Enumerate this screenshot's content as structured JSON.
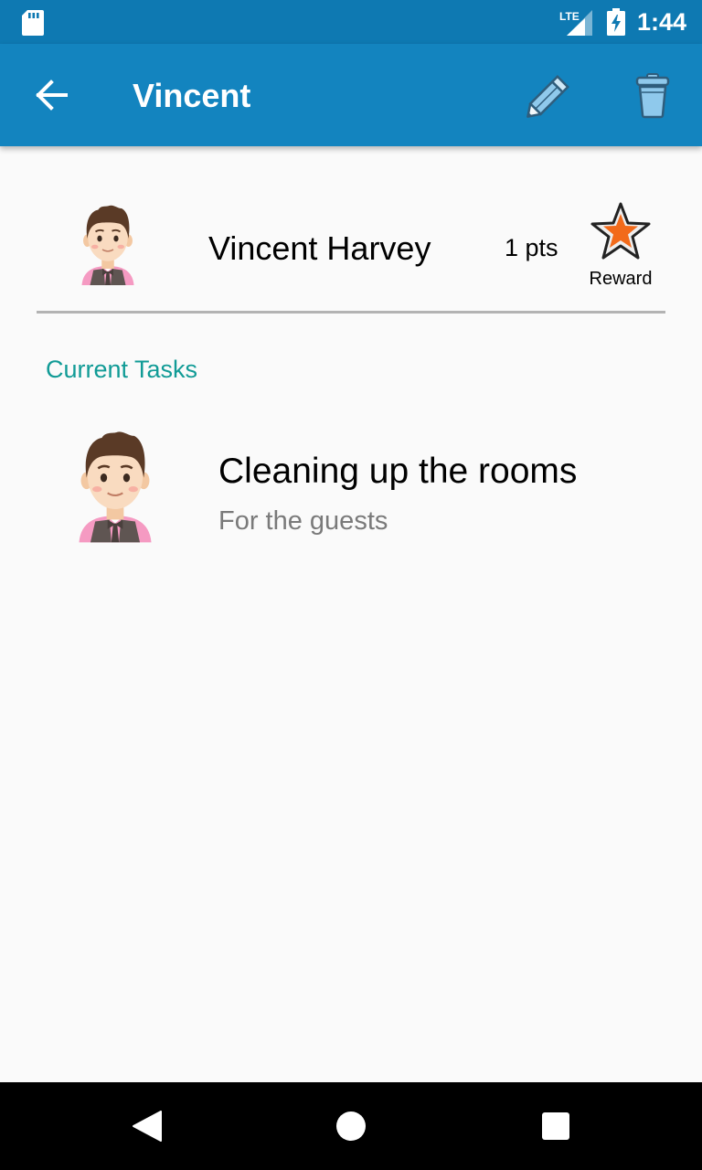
{
  "status_bar": {
    "time": "1:44",
    "network_label": "LTE",
    "icons": [
      "sd-card-icon",
      "lte-signal-icon",
      "battery-charging-icon"
    ]
  },
  "app_bar": {
    "title": "Vincent",
    "icons": [
      "back-arrow-icon",
      "pencil-icon",
      "trash-icon"
    ],
    "color": "#1384bf"
  },
  "profile": {
    "name": "Vincent Harvey",
    "points": "1 pts",
    "reward_label": "Reward",
    "avatar_icon": "waiter-avatar-icon",
    "reward_icon": "star-icon"
  },
  "tasks_section": {
    "heading": "Current Tasks",
    "heading_color": "#119b96",
    "tasks": [
      {
        "title": "Cleaning up the rooms",
        "subtitle": "For the guests",
        "icon": "waiter-avatar-icon"
      }
    ]
  },
  "nav_bar": {
    "icons": [
      "nav-back-icon",
      "nav-home-icon",
      "nav-recents-icon"
    ]
  }
}
